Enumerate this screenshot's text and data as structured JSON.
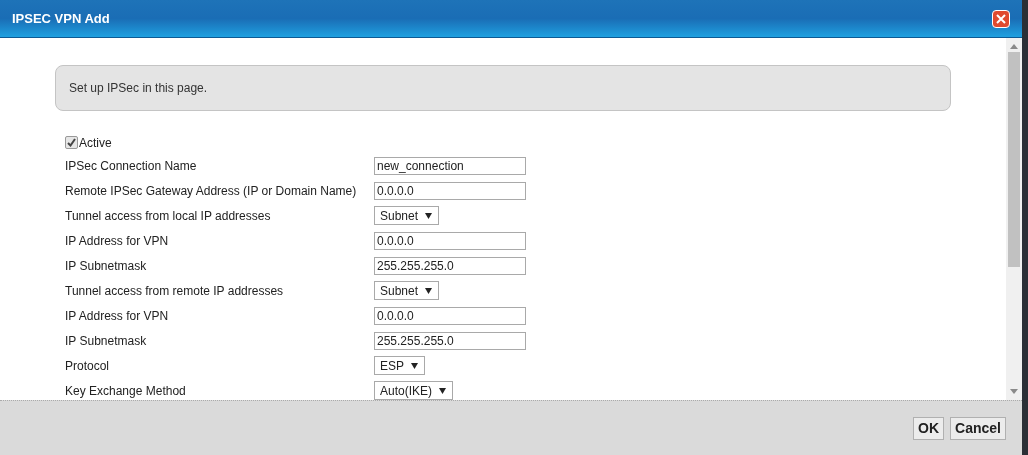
{
  "window": {
    "title": "IPSEC VPN Add"
  },
  "info": "Set up IPSec in this page.",
  "active": {
    "label": "Active",
    "checked": true
  },
  "fields": [
    {
      "kind": "text",
      "label": "IPSec Connection Name",
      "value": "new_connection"
    },
    {
      "kind": "text",
      "label": "Remote IPSec Gateway Address (IP or Domain Name)",
      "value": "0.0.0.0"
    },
    {
      "kind": "select",
      "label": "Tunnel access from local IP addresses",
      "value": "Subnet"
    },
    {
      "kind": "text",
      "label": "IP Address for VPN",
      "value": "0.0.0.0"
    },
    {
      "kind": "text",
      "label": "IP Subnetmask",
      "value": "255.255.255.0"
    },
    {
      "kind": "select",
      "label": "Tunnel access from remote IP addresses",
      "value": "Subnet"
    },
    {
      "kind": "text",
      "label": "IP Address for VPN",
      "value": "0.0.0.0"
    },
    {
      "kind": "text",
      "label": "IP Subnetmask",
      "value": "255.255.255.0"
    },
    {
      "kind": "select",
      "label": "Protocol",
      "value": "ESP"
    },
    {
      "kind": "select",
      "label": "Key Exchange Method",
      "value": "Auto(IKE)"
    }
  ],
  "buttons": [
    "OK",
    "Cancel"
  ]
}
